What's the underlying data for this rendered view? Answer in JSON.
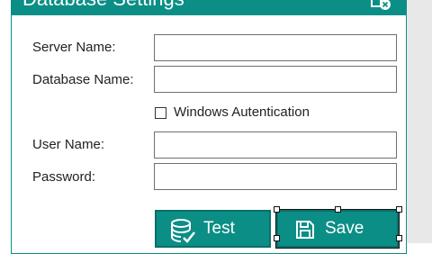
{
  "window": {
    "title": "Database Settings",
    "close_icon": "close-icon",
    "accent_color": "#0b8e86"
  },
  "form": {
    "server_name": {
      "label": "Server Name:",
      "value": ""
    },
    "database_name": {
      "label": "Database Name:",
      "value": ""
    },
    "windows_auth": {
      "label": "Windows Autentication",
      "checked": false
    },
    "user_name": {
      "label": "User Name:",
      "value": ""
    },
    "password": {
      "label": "Password:",
      "value": ""
    }
  },
  "buttons": {
    "test": {
      "label": "Test",
      "icon": "database-check-icon"
    },
    "save": {
      "label": "Save",
      "icon": "floppy-disk-icon"
    }
  }
}
